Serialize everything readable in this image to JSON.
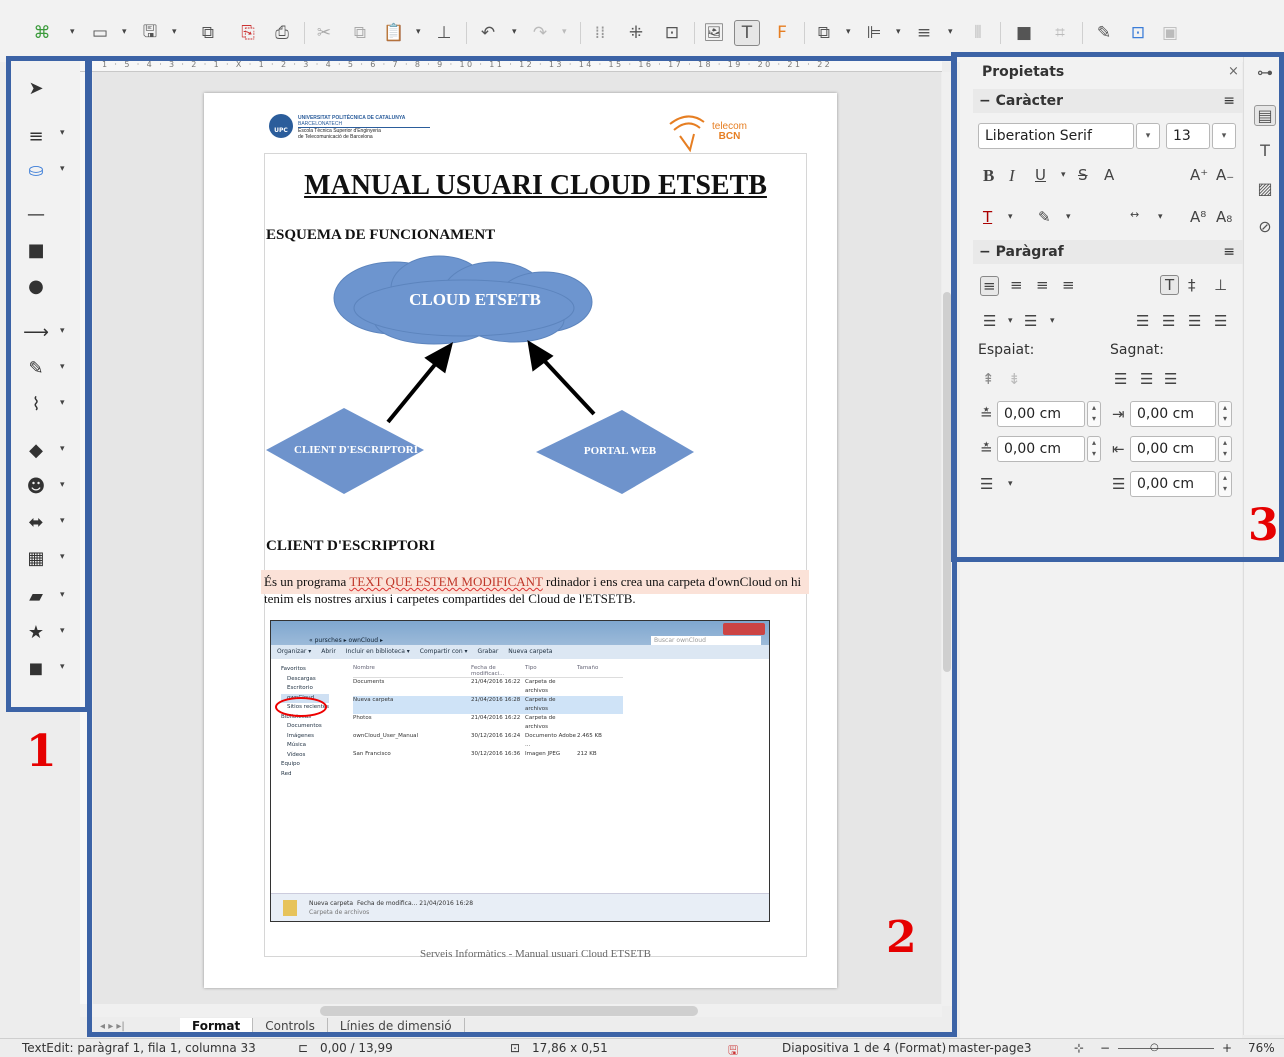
{
  "toolbar": {
    "icons": [
      "display-views-icon",
      "open-icon",
      "save-icon",
      "export-icon",
      "export-pdf-icon",
      "print-icon",
      "cut-icon",
      "copy-icon",
      "paste-icon",
      "clone-icon",
      "undo-icon",
      "redo-icon",
      "grid-icon",
      "helplines-icon",
      "zoom-pan-icon",
      "image-icon",
      "textbox-icon",
      "fontwork-icon",
      "transform-icon",
      "align-icon",
      "arrange-icon",
      "distribute-icon",
      "shadow-icon",
      "crop-icon",
      "points-icon",
      "glue-icon",
      "toggle-extrusion-icon"
    ]
  },
  "left_toolbar": {
    "icons": [
      "select-icon",
      "line-color-icon",
      "fill-color-icon",
      "line-icon",
      "rectangle-icon",
      "ellipse-icon",
      "arrow-line-icon",
      "curve-icon",
      "connector-icon",
      "basic-shapes-icon",
      "symbol-shapes-icon",
      "block-arrows-icon",
      "flowchart-icon",
      "callout-icon",
      "stars-icon",
      "3d-objects-icon"
    ]
  },
  "annotations": {
    "one": "1",
    "two": "2",
    "three": "3"
  },
  "ruler": {
    "marks": "1 · 5 · 4 · 3 · 2 · 1 · X · 1 · 2 · 3 · 4 · 5 · 6 · 7 · 8 · 9 · 10 · 11 · 12 · 13 · 14 · 15 · 16 · 17 · 18 · 19 · 20 · 21 · 22"
  },
  "document": {
    "upc_line1": "UNIVERSITAT POLITÈCNICA DE CATALUNYA",
    "upc_line2": "BARCELONATECH",
    "upc_line3": "Escola Tècnica Superior d'Enginyeria",
    "upc_line4": "de Telecomunicació de Barcelona",
    "upc_badge": "UPC",
    "telecom_line1": "telecom",
    "telecom_line2": "BCN",
    "title": "MANUAL USUARI CLOUD ETSETB",
    "heading1": "ESQUEMA DE FUNCIONAMENT",
    "cloud_label": "CLOUD ETSETB",
    "diamond_left": "CLIENT D'ESCRIPTORI",
    "diamond_right": "PORTAL WEB",
    "heading2": "CLIENT D'ESCRIPTORI",
    "body_part1": "És un programa ",
    "body_edited": "TEXT QUE ESTEM MODIFICANT",
    "body_part2": " rdinador i ens crea una carpeta d'ownCloud on hi tenim els nostres arxius i carpetes compartides del Cloud de l'ETSETB.",
    "footer": "Serveis Informàtics - Manual usuari Cloud ETSETB"
  },
  "screenshot": {
    "breadcrumb": "« pursches ▸ ownCloud ▸",
    "search": "Buscar ownCloud",
    "toolbar": [
      "Organizar ▾",
      "Abrir",
      "Incluir en biblioteca ▾",
      "Compartir con ▾",
      "Grabar",
      "Nueva carpeta"
    ],
    "columns": [
      "Nombre",
      "Fecha de modificaci...",
      "Tipo",
      "Tamaño"
    ],
    "nav": [
      "Favoritos",
      "Descargas",
      "Escritorio",
      "ownCloud",
      "Sitios recientes",
      "",
      "Bibliotecas",
      "Documentos",
      "Imágenes",
      "Música",
      "Vídeos",
      "",
      "Equipo",
      "",
      "Red"
    ],
    "files": [
      {
        "name": "Documents",
        "date": "21/04/2016 16:22",
        "type": "Carpeta de archivos",
        "size": ""
      },
      {
        "name": "Nueva carpeta",
        "date": "21/04/2016 16:28",
        "type": "Carpeta de archivos",
        "size": ""
      },
      {
        "name": "Photos",
        "date": "21/04/2016 16:22",
        "type": "Carpeta de archivos",
        "size": ""
      },
      {
        "name": "ownCloud_User_Manual",
        "date": "30/12/2016 16:24",
        "type": "Documento Adobe ...",
        "size": "2.465 KB"
      },
      {
        "name": "San Francisco",
        "date": "30/12/2016 16:36",
        "type": "Imagen JPEG",
        "size": "212 KB"
      }
    ],
    "details_name": "Nueva carpeta",
    "details_meta": "Fecha de modifica... 21/04/2016 16:28",
    "details_type": "Carpeta de archivos"
  },
  "tabs": [
    "Format",
    "Controls",
    "Línies de dimensió"
  ],
  "status": {
    "text_edit": "TextEdit: paràgraf 1, fila 1, columna 33",
    "position": "0,00 / 13,99",
    "size": "17,86 x 0,51",
    "slide": "Diapositiva 1 de 4 (Format)",
    "master": "master-page3",
    "zoom": "76%"
  },
  "sidebar": {
    "title": "Propietats",
    "char_title": "Caràcter",
    "font_name": "Liberation Serif",
    "font_size": "13",
    "para_title": "Paràgraf",
    "spacing_label": "Espaiat:",
    "indent_label": "Sagnat:",
    "above": "0,00 cm",
    "below": "0,00 cm",
    "before_text": "0,00 cm",
    "after_text": "0,00 cm",
    "first_line": "0,00 cm"
  },
  "colors": {
    "frame": "#3c63a6",
    "annotation": "#e60000",
    "cloud": "#6d95cf",
    "diamond": "#6e93cc",
    "edited_text": "#c0392b"
  }
}
